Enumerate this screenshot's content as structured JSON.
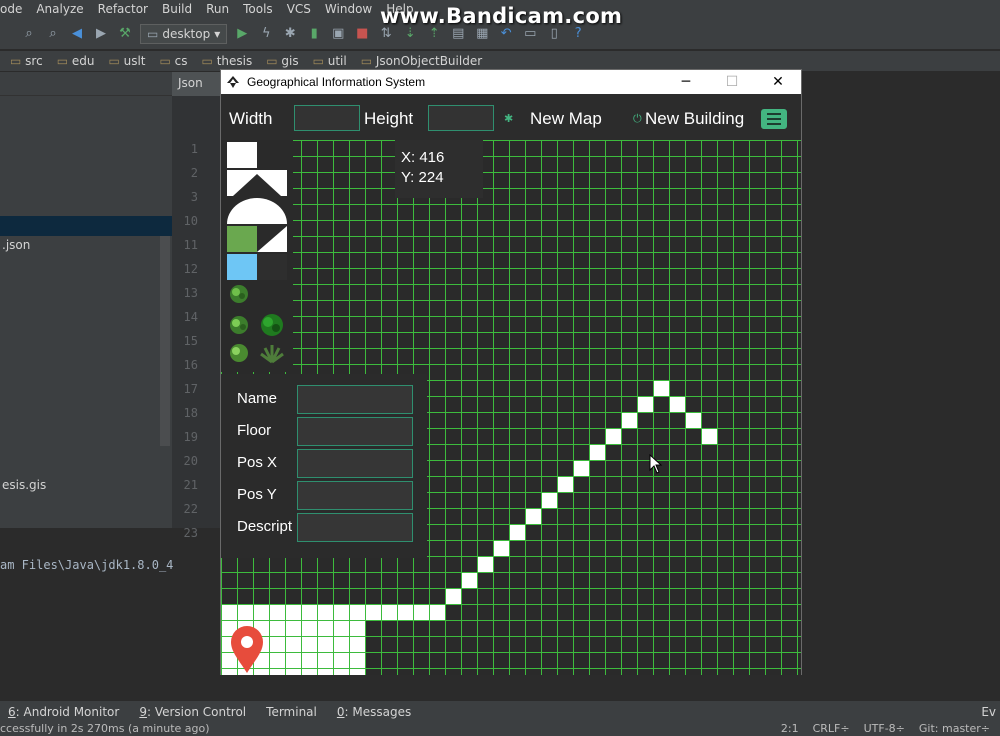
{
  "watermark": "www.Bandicam.com",
  "ide": {
    "menu": [
      "ode",
      "Analyze",
      "Refactor",
      "Build",
      "Run",
      "Tools",
      "VCS",
      "Window",
      "Help"
    ],
    "run_config": "desktop",
    "breadcrumbs": [
      "src",
      "edu",
      "uslt",
      "cs",
      "thesis",
      "gis",
      "util",
      "JsonObjectBuilder"
    ],
    "editor_tab": "Json",
    "sidebar_files": [
      ".json",
      "esis.gis"
    ],
    "console_path": "am Files\\Java\\jdk1.8.0_4",
    "bottom_tools": [
      {
        "num": "6",
        "label": ": Android Monitor"
      },
      {
        "num": "9",
        "label": ": Version Control"
      },
      {
        "num": "",
        "label": "Terminal"
      },
      {
        "num": "0",
        "label": ": Messages"
      }
    ],
    "status_left": "ccessfully in 2s 270ms (a minute ago)",
    "status_right": [
      "2:1",
      "CRLF÷",
      "UTF-8÷",
      "Git: master÷"
    ],
    "event_log": "Ev"
  },
  "app": {
    "title": "Geographical Information System",
    "width_label": "Width",
    "height_label": "Height",
    "width_value": "",
    "height_value": "",
    "new_map": "New Map",
    "new_building": "New Building",
    "coords": {
      "x_label": "X: 416",
      "y_label": "Y: 224"
    },
    "form": {
      "name_label": "Name",
      "floor_label": "Floor",
      "posx_label": "Pos X",
      "posy_label": "Pos Y",
      "desc_label": "Descript"
    },
    "gutter_lines": [
      "1",
      "2",
      "3",
      "10",
      "11",
      "12",
      "13",
      "14",
      "15",
      "16",
      "17",
      "18",
      "19",
      "20",
      "21",
      "22",
      "23"
    ],
    "colors": {
      "grid": "#3dbb3d",
      "accent": "#43b581",
      "tile_green": "#6aa84f",
      "tile_blue": "#6ec6f5",
      "pin": "#e74c3c"
    }
  }
}
